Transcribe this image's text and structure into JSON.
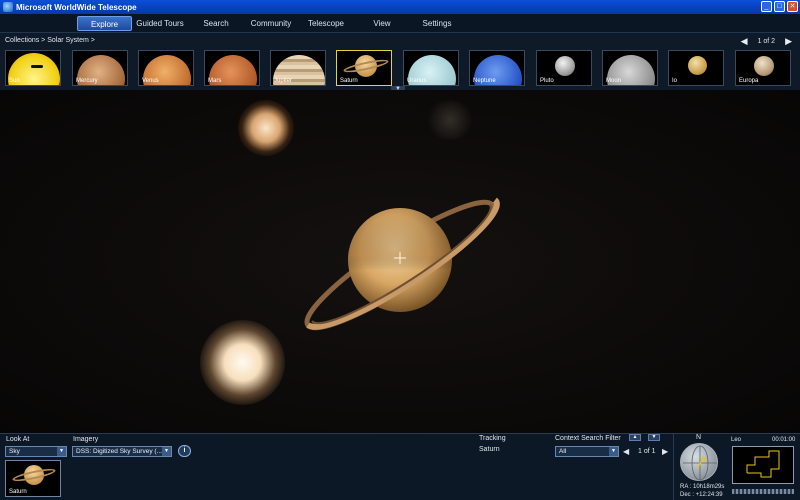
{
  "window": {
    "title": "Microsoft WorldWide Telescope"
  },
  "menu": {
    "items": [
      {
        "label": "Explore"
      },
      {
        "label": "Guided Tours"
      },
      {
        "label": "Search"
      },
      {
        "label": "Community"
      },
      {
        "label": "Telescope"
      },
      {
        "label": "View"
      },
      {
        "label": "Settings"
      }
    ],
    "active": "Explore"
  },
  "collections": {
    "breadcrumb": "Collections  > Solar System  >",
    "page_indicator": "1 of 2",
    "items": [
      {
        "label": "Sun"
      },
      {
        "label": "Mercury"
      },
      {
        "label": "Venus"
      },
      {
        "label": "Mars"
      },
      {
        "label": "Jupiter"
      },
      {
        "label": "Saturn"
      },
      {
        "label": "Uranus"
      },
      {
        "label": "Neptune"
      },
      {
        "label": "Pluto"
      },
      {
        "label": "Moon"
      },
      {
        "label": "Io"
      },
      {
        "label": "Europa"
      }
    ],
    "selected": "Saturn"
  },
  "bottom": {
    "look_at_label": "Look At",
    "look_at_value": "Sky",
    "imagery_label": "Imagery",
    "imagery_value": "DSS: Digitized Sky Survey (...",
    "current_thumb_label": "Saturn",
    "tracking_label": "Tracking",
    "tracking_value": "Saturn",
    "context_filter_label": "Context Search Filter",
    "context_filter_value": "All",
    "context_page": "1 of 1",
    "compass_north": "N",
    "ra": "RA :  10h18m29s",
    "dec": "Dec :  +12:24:39",
    "constellation": "Leo",
    "time": "00:01:00"
  },
  "colors": {
    "accent": "#3b72c9",
    "selected_border": "#e5d13a",
    "titlebar": "#0a4fd8"
  }
}
